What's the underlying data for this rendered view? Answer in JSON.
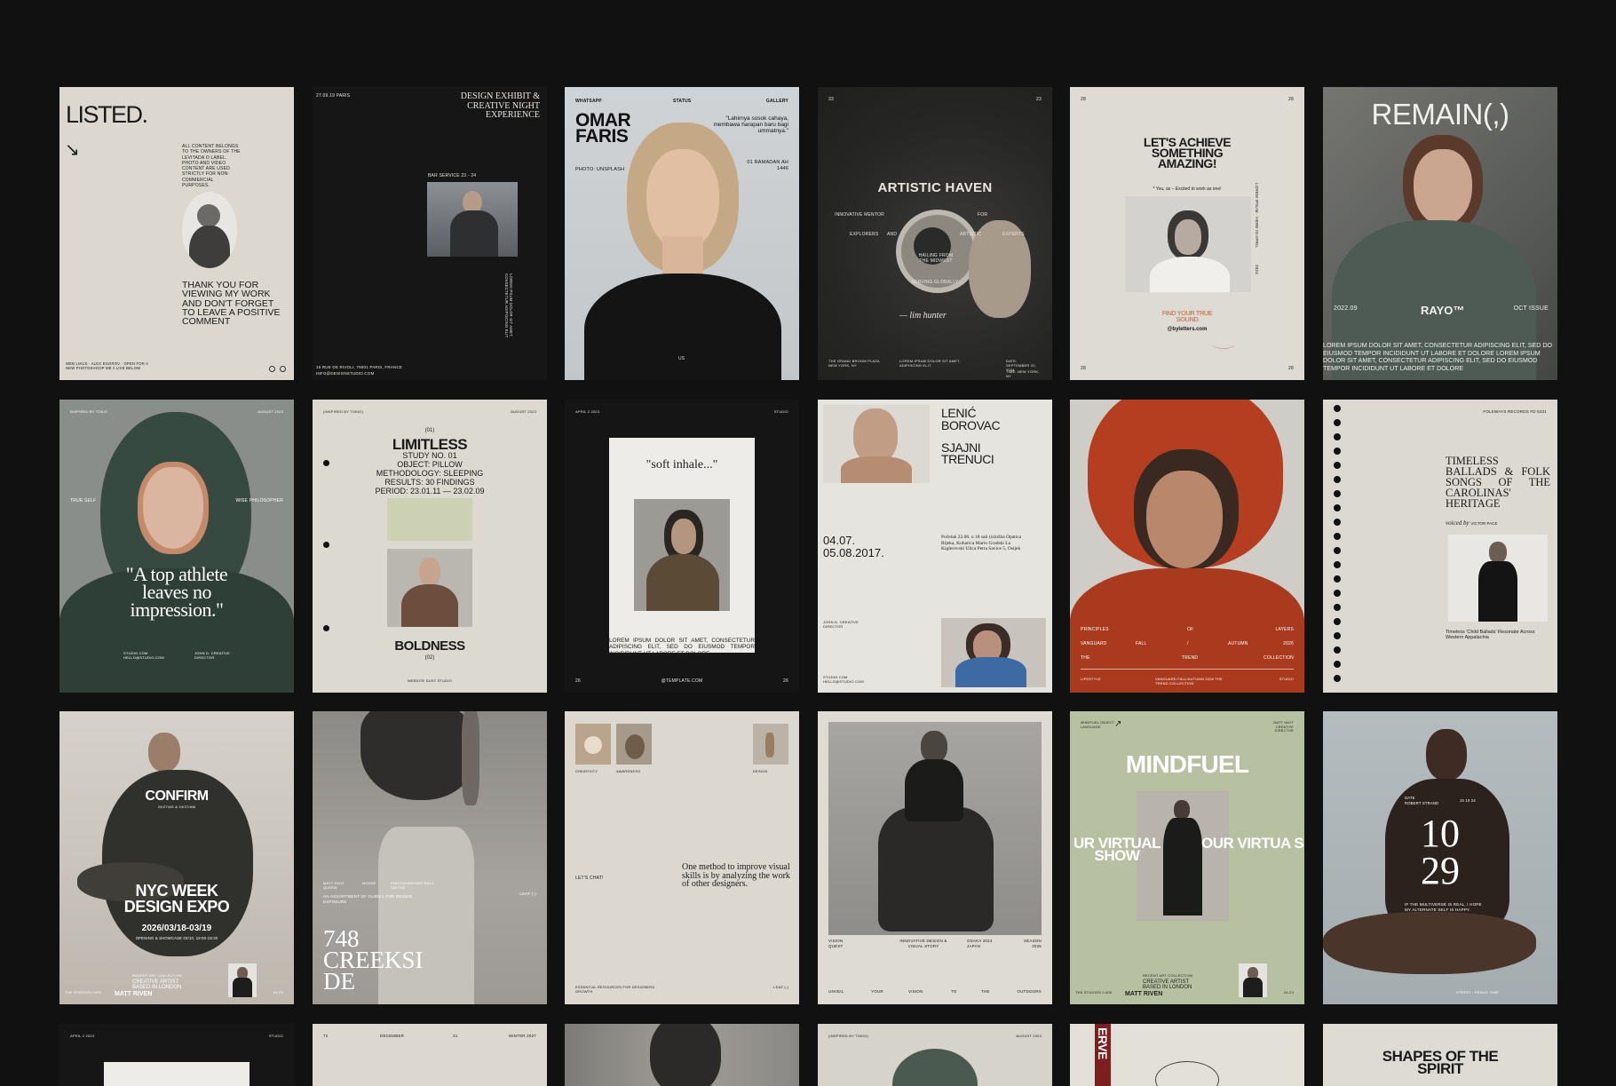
{
  "cards": {
    "c1": {
      "title": "LISTED.",
      "arrow": "↘",
      "legal": "ALL CONTENT BELONGS TO THE OWNERS OF THE LEVITADA O LABEL. PHOTO AND VIDEO CONTENT ARE USED STRICTLY FOR NON-COMMERCIAL PURPOSES.",
      "thanks": "THANK YOU FOR VIEWING MY WORK AND DON'T FORGET TO LEAVE A POSITIVE COMMENT",
      "footer": "WEB LIKUS · ALEX EGOROV · OPEN FOR A NEW PHOTOSHOOP ME A LIVE BELOW"
    },
    "c2": {
      "date": "27.09.19 PARIS",
      "title": "DESIGN EXHIBIT & CREATIVE NIGHT EXPERIENCE",
      "service": "BAR SERVICE 23 - 24",
      "vertical": "LOREM IPSUM DOLOR SIT AMET, CONSECTETUR ADIPISCING ELIT",
      "address": "15 RUE DE RIVOLI, 75001 PARIS, FRANCE",
      "email": "INFO@DESIGNSTUDIO.COM"
    },
    "c3": {
      "nav": [
        "WHATSAPP",
        "STATUS",
        "GALLERY"
      ],
      "name": "OMAR FARIS",
      "quote": "\"Lahirnya sosok cahaya, membawa harapan baru bagi ummatnya.\"",
      "photo": "PHOTO: UNSPLASH",
      "date": "01 RAMADAN AH 1446",
      "mark": "US"
    },
    "c4": {
      "n1": "33",
      "n2": "23",
      "title": "ARTISTIC HAVEN",
      "w1": "INNOVATIVE MENTOR",
      "w2": "FOR",
      "w3": "EXPLORERS",
      "w4": "AND",
      "w5": "ARTISTIC",
      "w6": "EXPERTS",
      "center": "HAILING FROM THE MIDWEST",
      "serving": "SERVING GLOBALLY",
      "sign": "— lim hunter",
      "f1": "THE GRAND BROOM PLAZA NEW YORK, NY",
      "f2": "LOREM IPSUM DOLOR SIT AMET, ADIPISCING ELIT.",
      "f3": "DATE: SEPTEMBER 20, 2024",
      "f4": "TIME: NEW YORK, NY"
    },
    "c5": {
      "n1": "28",
      "n2": "28",
      "title": "LET'S ACHIEVE SOMETHING AMAZING!",
      "sub": "* You, as – Excited to work as one!",
      "side": "Lorem Ipsum · Here in April",
      "year": "2024",
      "find": "FIND YOUR TRUE SOUND",
      "handle": "@byletters.com",
      "n3": "28",
      "n4": "28"
    },
    "c6": {
      "title": "REMAIN(,)",
      "date": "2022.09",
      "brand": "RAYO™",
      "issue": "OCT ISSUE",
      "body": "LOREM IPSUM DOLOR SIT AMET, CONSECTETUR ADIPISCING ELIT, SED DO EIUSMOD TEMPOR INCIDIDUNT UT LABORE ET DOLORE LOREM IPSUM DOLOR SIT AMET, CONSECTETUR ADIPISCING ELIT, SED DO EIUSMOD TEMPOR INCIDIDUNT UT LABORE ET DOLORE"
    },
    "c7": {
      "tl": "INSPIRED BY TOKIO",
      "tr": "AUGUST 2023",
      "l": "TRUE SELF",
      "r": "WISE PHILOSOPHER",
      "quote": "\"A top athlete leaves no impression.\"",
      "f1": "STUDIO.COM HELLO@STUDIO.COM",
      "f2": "JOHN D. CREATIVE DIRECTOR"
    },
    "c8": {
      "tl": "(INSPIRED BY TOKIO)",
      "tr": "AUGUST 2023",
      "num": "(01)",
      "title": "LIMITLESS",
      "lines": [
        "STUDY NO. 01",
        "OBJECT: PILLOW",
        "METHODOLOGY: SLEEPING",
        "RESULTS: 30 FINDINGS",
        "PERIOD: 23.01.11 — 23.02.09"
      ],
      "bottom": "BOLDNESS",
      "num2": "(02)",
      "footer": "WEBSITE DUST STUDIO"
    },
    "c9": {
      "tl": "APRIL 2 2023",
      "tr": "STUDIO",
      "quote": "\"soft inhale...\"",
      "body": "LOREM IPSUM DOLOR SIT AMET, CONSECTETUR ADIPISCING ELIT, SED DO EIUSMOD TEMPOR INCIDIDUNT UT LABORE ET DOLORE",
      "n1": "26",
      "site": "@TEMPLATE.COM",
      "n2": "26"
    },
    "c10": {
      "name1": "LENIĆ",
      "name2": "BOROVAC",
      "t1": "SJAJNI",
      "t2": "TRENUCI",
      "d1": "04.07.",
      "d2": "05.08.2017.",
      "body": "Početak 22.06. u 18 sati (izložba Opatica Rijeka, Kuharica Mario Gradski La Kiglerovski Ulica Petra Savice 5, Osijek",
      "r1": "JOHN D. CREATIVE DIRECTOR",
      "r2": "STUDIO.COM HELLO@STUDIO.COM"
    },
    "c11": {
      "r1": [
        "PRINCIPLES",
        "OF",
        "LAYERS"
      ],
      "r2": [
        "VANGUARD",
        "FALL",
        "/",
        "AUTUMN",
        "2026"
      ],
      "r3": [
        "THE",
        "TREND",
        "COLLECTION"
      ],
      "f1": "LIFESTYLE",
      "f2": "VANGUARD FALL/AUTUMN 2026 THE TREND COLLECTION",
      "f3": "STUDIO"
    },
    "c12": {
      "tr": "FOLKWAYS RECORDS FD 5331",
      "title": "TIMELESS BALLADS & FOLK SONGS OF THE CAROLINAS' HERITAGE",
      "by": "voiced by",
      "name": "VICTOR PACE",
      "cap": "Timeless 'Child Ballads' Resonate Across Western Appalachia"
    },
    "c13": {
      "title": "CONFIRM",
      "small": "24/27/AS & 24/27/AM",
      "h1": "NYC WEEK",
      "h2": "DESIGN EXPO",
      "date": "2026/03/18-03/19",
      "open": "OPENING & SHOWCASE 03/10, 18:00-19:30",
      "f1": "THE STUDIOS 0.600",
      "f2": "RECENT ART COLLECTION",
      "f3": "CREATIVE ARTIST BASED IN LONDON",
      "f4": "MATT RIVEN",
      "f5": "24-24"
    },
    "c14": {
      "cols": [
        "MATT FACE QUEEN",
        "MOSSE",
        "PHOTOGRAPHER RAUL SMITHS"
      ],
      "body": "AN ASSORTMENT OF GUIDES FOR DESIGN EXPOSURE",
      "leaf": "LEAF (-)",
      "num": "748",
      "l1": "CREEKSI",
      "l2": "DE"
    },
    "c15": {
      "lab1": "CREATIVITY",
      "lab2": "AWARENESS",
      "lab3": "DESIGN",
      "chat": "LET'S CHAT!",
      "quote": "One method to improve visual skills is by analyzing the work of other designers.",
      "f1": "ESSENTIAL RESOURCES FOR DESIGNERS GROWTH",
      "f2": "LEAF (-)"
    },
    "c16": {
      "f1": "VISION QUEST",
      "f2": "INNOVATIVE DESIGN & VISUAL STORY",
      "f3": "OSAKA 2024 JAPAN",
      "f4": "SEASON 2026",
      "b": [
        "UNVEIL",
        "YOUR",
        "VISION",
        "TO",
        "THE",
        "OUTDOORS"
      ]
    },
    "c17": {
      "tl": "MINDFUEL OBJECT LANGUAGE",
      "tr": "MATT HAYT CREATIVE DIRECTOR",
      "arrow": "↗",
      "title": "MINDFUEL",
      "s1": "UR VIRTUAL SHOW",
      "s2": "OUR VIRTUA SHOW",
      "f1": "THE STUDIOS 0.600",
      "f2": "CREATIVE ARTIST BASED IN LONDON",
      "f3": "MATT RIVEN",
      "f4": "RECENT ART COLLECTION",
      "f5": "24-24"
    },
    "c18": {
      "l1": "DATE",
      "l2": "ROBERT STRAND",
      "r1": "10 10 24",
      "num1": "10",
      "num2": "29",
      "body": "IF THE MULTIVERSE IS REAL, I HOPE MY ALTERNATE SELF IS HAPPY.",
      "foot": "STREET / FRIDAY TIME"
    },
    "c19": {
      "tl": "APRIL 2 2023",
      "tr": "STUDIO"
    },
    "c20": {
      "l": "72",
      "m": "DECEMBER",
      "n": "31",
      "r": "WINTER 2027"
    },
    "c22": {
      "tl": "(INSPIRED BY TOKIO)",
      "tr": "AUGUST 2023"
    },
    "c23": {
      "band": "ERVE"
    },
    "c24": {
      "title": "SHAPES OF THE SPIRIT"
    }
  }
}
